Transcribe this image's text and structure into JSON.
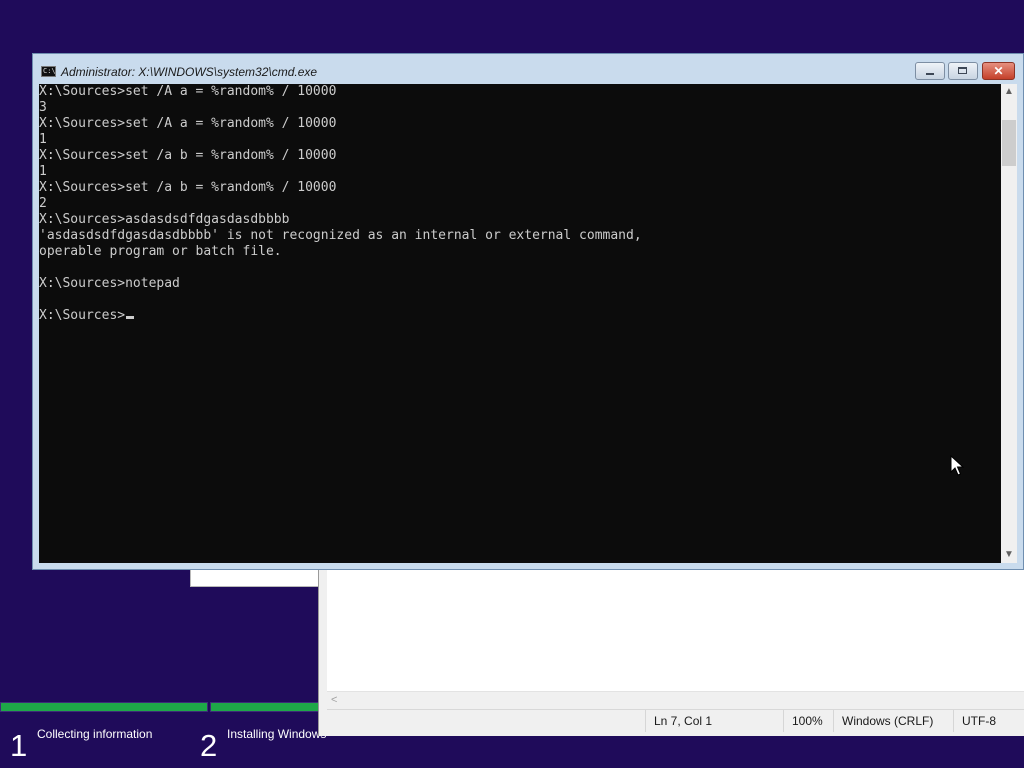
{
  "setup": {
    "progress": {
      "step1_fraction": 1.0,
      "step2_fraction": 1.0
    },
    "steps": [
      {
        "number": "1",
        "label": "Collecting information"
      },
      {
        "number": "2",
        "label": "Installing Windows"
      }
    ]
  },
  "cmd": {
    "title": "Administrator: X:\\WINDOWS\\system32\\cmd.exe",
    "icon": "C:\\",
    "buttons": {
      "minimize": "minimize",
      "maximize": "maximize",
      "close": "✕"
    },
    "lines": [
      "X:\\Sources>set /A a = %random% / 10000",
      "3",
      "X:\\Sources>set /A a = %random% / 10000",
      "1",
      "X:\\Sources>set /a b = %random% / 10000",
      "1",
      "X:\\Sources>set /a b = %random% / 10000",
      "2",
      "X:\\Sources>asdasdsdfdgasdasdbbbb",
      "'asdasdsdfdgasdasdbbbb' is not recognized as an internal or external command,",
      "operable program or batch file.",
      "",
      "X:\\Sources>notepad",
      "",
      "X:\\Sources>"
    ],
    "scroll": {
      "up": "▲",
      "down": "▼"
    }
  },
  "notepad": {
    "status": {
      "position": "Ln 7, Col 1",
      "zoom": "100%",
      "line_ending": "Windows (CRLF)",
      "encoding": "UTF-8"
    },
    "hscroll_left": "<"
  },
  "colors": {
    "desktop": "#1f0b5a",
    "progress_fill": "#1ea848",
    "console_bg": "#0c0c0c",
    "console_text": "#cccccc",
    "cmd_frame": "#c9dbed"
  }
}
